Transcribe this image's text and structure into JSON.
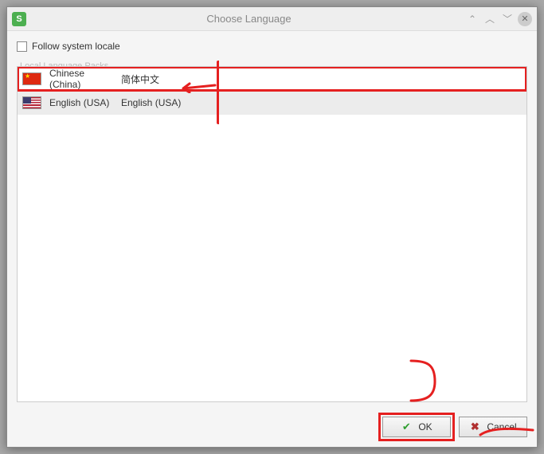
{
  "titlebar": {
    "title": "Choose Language"
  },
  "checkbox": {
    "label": "Follow system locale"
  },
  "group": {
    "label": "Local Language Packs"
  },
  "languages": [
    {
      "name": "Chinese (China)",
      "native": "简体中文"
    },
    {
      "name": "English (USA)",
      "native": "English (USA)"
    }
  ],
  "buttons": {
    "ok": "OK",
    "cancel": "Cancel"
  }
}
